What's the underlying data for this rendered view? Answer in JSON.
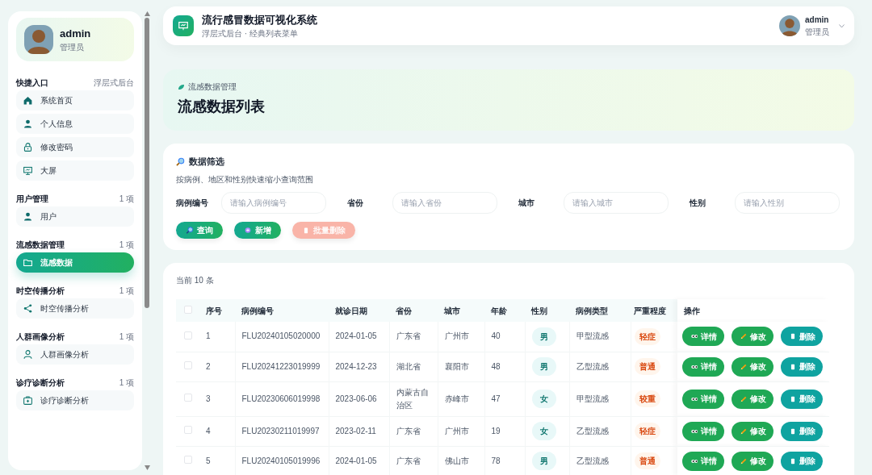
{
  "sidebar": {
    "profile": {
      "name": "admin",
      "role": "管理员"
    },
    "groups": [
      {
        "title": "快捷入口",
        "note": "浮层式后台",
        "items": [
          {
            "label": "系统首页",
            "kind": "home",
            "selected": false
          },
          {
            "label": "个人信息",
            "kind": "person",
            "selected": false
          },
          {
            "label": "修改密码",
            "kind": "lock",
            "selected": false
          },
          {
            "label": "大屏",
            "kind": "screen",
            "selected": false
          }
        ]
      },
      {
        "title": "用户管理",
        "note": "1 项",
        "items": [
          {
            "label": "用户",
            "kind": "person",
            "selected": false
          }
        ]
      },
      {
        "title": "流感数据管理",
        "note": "1 项",
        "items": [
          {
            "label": "流感数据",
            "kind": "folder",
            "selected": true
          }
        ]
      },
      {
        "title": "时空传播分析",
        "note": "1 项",
        "items": [
          {
            "label": "时空传播分析",
            "kind": "share",
            "selected": false
          }
        ]
      },
      {
        "title": "人群画像分析",
        "note": "1 项",
        "items": [
          {
            "label": "人群画像分析",
            "kind": "outline",
            "selected": false
          }
        ]
      },
      {
        "title": "诊疗诊断分析",
        "note": "1 项",
        "items": [
          {
            "label": "诊疗诊断分析",
            "kind": "medkit",
            "selected": false
          }
        ]
      }
    ]
  },
  "header": {
    "title": "流行感冒数据可视化系统",
    "subtitle": "浮层式后台 · 经典列表菜单",
    "user": {
      "name": "admin",
      "role": "管理员"
    }
  },
  "page_title": {
    "breadcrumb": "流感数据管理",
    "title": "流感数据列表"
  },
  "filter": {
    "title": "数据筛选",
    "description": "按病例、地区和性别快速缩小查询范围",
    "fields": [
      {
        "label": "病例编号",
        "placeholder": "请输入病例编号"
      },
      {
        "label": "省份",
        "placeholder": "请输入省份"
      },
      {
        "label": "城市",
        "placeholder": "请输入城市"
      },
      {
        "label": "性别",
        "placeholder": "请输入性别"
      }
    ],
    "buttons": [
      {
        "label": "查询",
        "kind": "search",
        "disabled": false
      },
      {
        "label": "新增",
        "kind": "add",
        "disabled": false
      },
      {
        "label": "批量删除",
        "kind": "delete",
        "disabled": true
      }
    ]
  },
  "table": {
    "count": "当前 10 条",
    "header_checked": false,
    "columns": [
      "序号",
      "病例编号",
      "就诊日期",
      "省份",
      "城市",
      "年龄",
      "性别",
      "病例类型",
      "严重程度",
      "操作"
    ],
    "rows": [
      {
        "checked": false,
        "cells": [
          "1",
          "FLU20240105020000",
          "2024-01-05",
          "广东省",
          "广州市",
          "40",
          "男",
          "甲型流感",
          "轻症"
        ],
        "actions": [
          "详情",
          "修改",
          "删除"
        ]
      },
      {
        "checked": false,
        "cells": [
          "2",
          "FLU20241223019999",
          "2024-12-23",
          "湖北省",
          "襄阳市",
          "48",
          "男",
          "乙型流感",
          "普通"
        ],
        "actions": [
          "详情",
          "修改",
          "删除"
        ]
      },
      {
        "checked": false,
        "cells": [
          "3",
          "FLU20230606019998",
          "2023-06-06",
          "内蒙古自治区",
          "赤峰市",
          "47",
          "女",
          "甲型流感",
          "较重"
        ],
        "actions": [
          "详情",
          "修改",
          "删除"
        ]
      },
      {
        "checked": false,
        "cells": [
          "4",
          "FLU20230211019997",
          "2023-02-11",
          "广东省",
          "广州市",
          "19",
          "女",
          "乙型流感",
          "轻症"
        ],
        "actions": [
          "详情",
          "修改",
          "删除"
        ]
      },
      {
        "checked": false,
        "cells": [
          "5",
          "FLU20240105019996",
          "2024-01-05",
          "广东省",
          "佛山市",
          "78",
          "男",
          "乙型流感",
          "普通"
        ],
        "actions": [
          "详情",
          "修改",
          "删除"
        ]
      }
    ]
  }
}
